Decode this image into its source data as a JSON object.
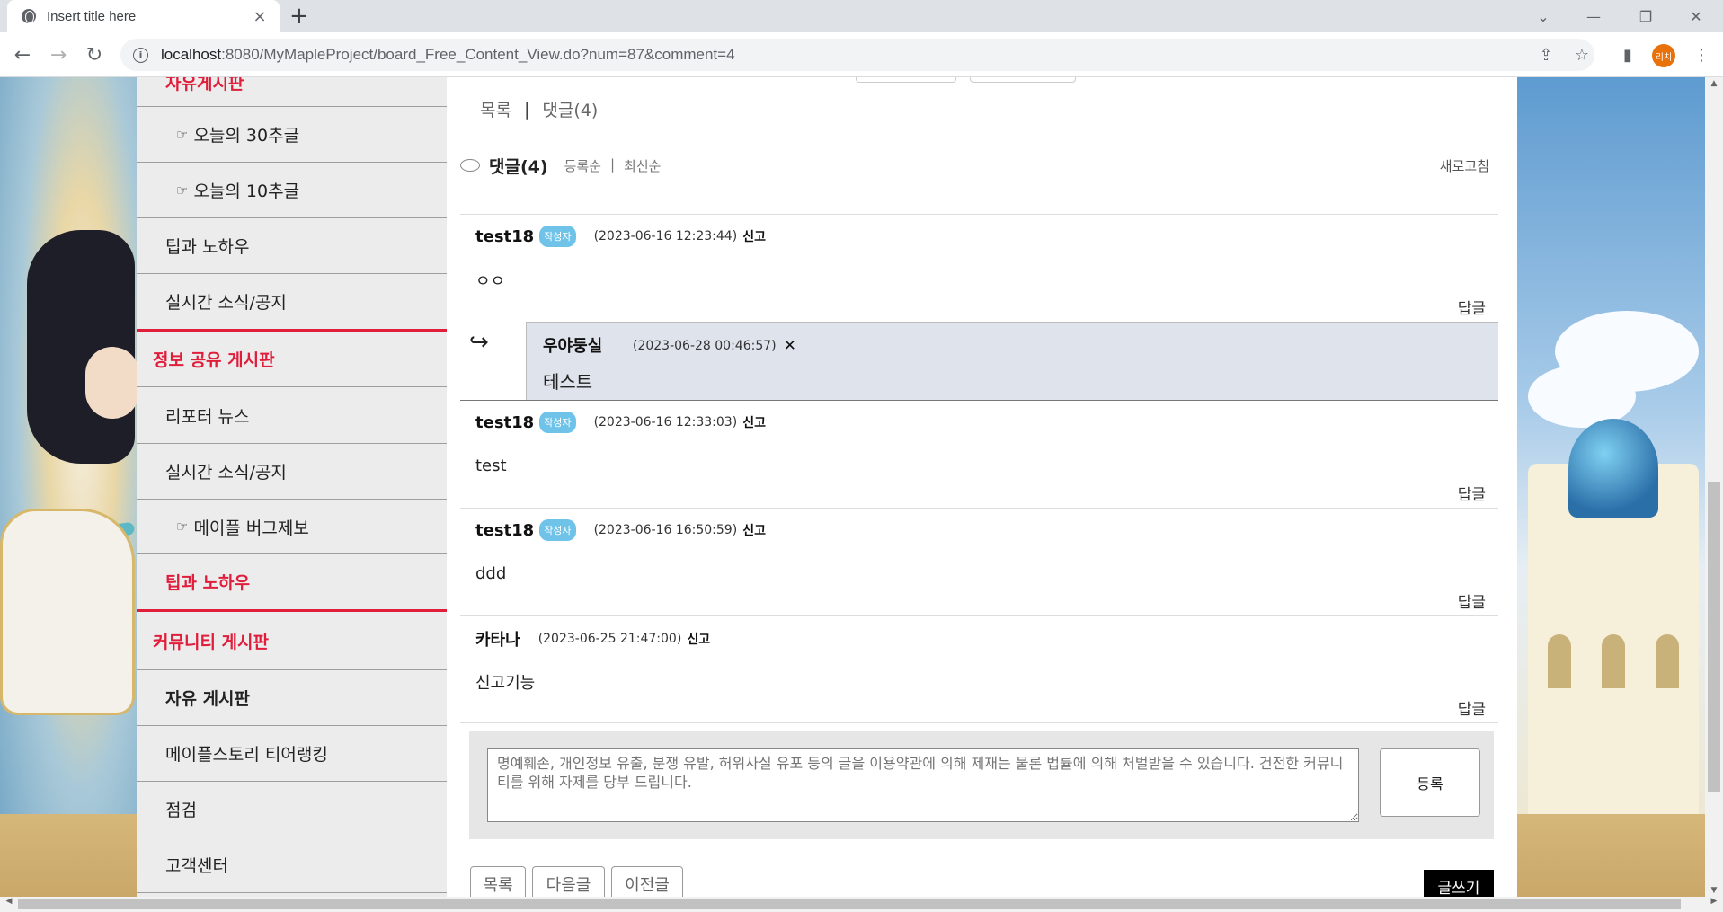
{
  "browser": {
    "tab_title": "Insert title here",
    "url_host": "localhost",
    "url_rest": ":8080/MyMapleProject/board_Free_Content_View.do?num=87&comment=4",
    "profile_initials": "리치"
  },
  "sidebar": {
    "items": [
      {
        "label": "자유게시판",
        "style": "current"
      },
      {
        "label": "오늘의 30추글",
        "style": "sub"
      },
      {
        "label": "오늘의 10추글",
        "style": "sub"
      },
      {
        "label": "팁과 노하우",
        "style": "normal"
      },
      {
        "label": "실시간 소식/공지",
        "style": "normal"
      },
      {
        "label": "정보 공유 게시판",
        "style": "head"
      },
      {
        "label": "리포터 뉴스",
        "style": "normal"
      },
      {
        "label": "실시간 소식/공지",
        "style": "normal"
      },
      {
        "label": "메이플 버그제보",
        "style": "sub"
      },
      {
        "label": "팁과 노하우",
        "style": "current"
      },
      {
        "label": "커뮤니티 게시판",
        "style": "head"
      },
      {
        "label": "자유 게시판",
        "style": "bold"
      },
      {
        "label": "메이플스토리 티어랭킹",
        "style": "normal"
      },
      {
        "label": "점검",
        "style": "normal"
      },
      {
        "label": "고객센터",
        "style": "normal"
      }
    ]
  },
  "nav": {
    "list_label": "목록",
    "separator": "|",
    "comments_label": "댓글(4)"
  },
  "comments_header": {
    "title": "댓글(4)",
    "sort_registered": "등록순",
    "sort_sep": "|",
    "sort_latest": "최신순",
    "refresh_label": "새로고침"
  },
  "comments": [
    {
      "author": "test18",
      "badge": "작성자",
      "date": "(2023-06-16 12:23:44)",
      "report": "신고",
      "body": "ㅇㅇ",
      "reply_label": "답글"
    },
    {
      "author": "test18",
      "badge": "작성자",
      "date": "(2023-06-16 12:33:03)",
      "report": "신고",
      "body": "test",
      "reply_label": "답글"
    },
    {
      "author": "test18",
      "badge": "작성자",
      "date": "(2023-06-16 16:50:59)",
      "report": "신고",
      "body": "ddd",
      "reply_label": "답글"
    },
    {
      "author": "카타나",
      "badge": "",
      "date": "(2023-06-25 21:47:00)",
      "report": "신고",
      "body": "신고기능",
      "reply_label": "답글"
    }
  ],
  "reply": {
    "arrow": "↪",
    "author": "우야둥실",
    "date": "(2023-06-28 00:46:57)",
    "delete_mark": "✕",
    "body": "테스트"
  },
  "write": {
    "placeholder": "명예훼손, 개인정보 유출, 분쟁 유발, 허위사실 유포 등의 글을 이용약관에 의해 제재는 물론 법률에 의해 처벌받을 수 있습니다. 건전한 커뮤니티를 위해 자제를 당부 드립니다.",
    "submit_label": "등록"
  },
  "bottom_buttons": {
    "list": "목록",
    "next": "다음글",
    "prev": "이전글",
    "write": "글쓰기"
  },
  "icons": {
    "back": "back-arrow-icon",
    "forward": "forward-arrow-icon",
    "reload": "reload-icon",
    "share": "share-icon",
    "bookmark": "star-icon",
    "sidepanel": "side-panel-icon",
    "menu": "kebab-menu-icon"
  }
}
